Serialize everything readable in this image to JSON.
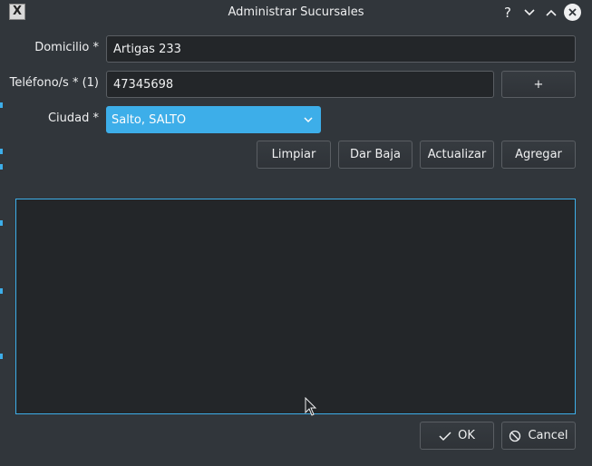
{
  "window": {
    "title": "Administrar Sucursales",
    "help_glyph": "?",
    "app_icon_glyph": "X"
  },
  "form": {
    "domicilio_label": "Domicilio *",
    "domicilio_value": "Artigas 233",
    "telefono_label": "Teléfono/s * (1)",
    "telefono_value": "47345698",
    "add_phone_label": "+",
    "ciudad_label": "Ciudad *",
    "ciudad_value": "Salto, SALTO"
  },
  "actions": {
    "limpiar": "Limpiar",
    "dar_baja": "Dar Baja",
    "actualizar": "Actualizar",
    "agregar": "Agregar"
  },
  "dialog_buttons": {
    "ok": "OK",
    "cancel": "Cancel"
  },
  "colors": {
    "background": "#31363b",
    "field_bg": "#232629",
    "accent": "#3daee9",
    "text": "#eff0f1"
  }
}
